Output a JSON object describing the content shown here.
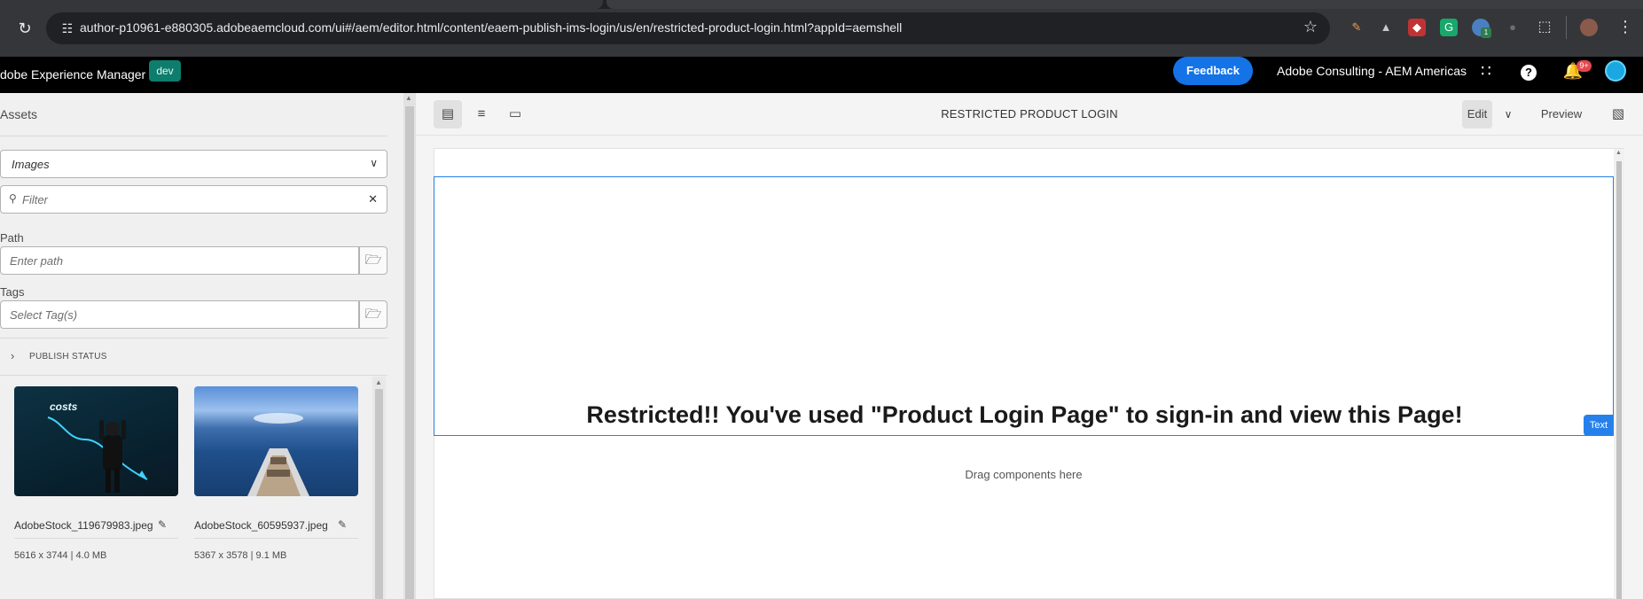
{
  "browser": {
    "url": "author-p10961-e880305.adobeaemcloud.com/ui#/aem/editor.html/content/eaem-publish-ims-login/us/en/restricted-product-login.html?appId=aemshell",
    "extension_badge": "1"
  },
  "aem_header": {
    "brand": "dobe Experience Manager",
    "env_badge": "dev",
    "feedback_label": "Feedback",
    "org_name": "Adobe Consulting - AEM Americas",
    "notification_count": "9+"
  },
  "assets_panel": {
    "title": "Assets",
    "type_select": "Images",
    "filter_placeholder": "Filter",
    "path_label": "Path",
    "path_placeholder": "Enter path",
    "tags_label": "Tags",
    "tags_placeholder": "Select Tag(s)",
    "publish_status_label": "PUBLISH STATUS",
    "cards": [
      {
        "name": "AdobeStock_119679983.jpeg",
        "meta": "5616 x 3744 | 4.0 MB",
        "thumb_text": "costs"
      },
      {
        "name": "AdobeStock_60595937.jpeg",
        "meta": "5367 x 3578 | 9.1 MB"
      }
    ]
  },
  "editor": {
    "page_title": "RESTRICTED PRODUCT LOGIN",
    "edit_label": "Edit",
    "preview_label": "Preview",
    "headline": "Restricted!! You've used \"Product Login Page\" to sign-in and view this Page!",
    "component_tag": "Text",
    "drop_zone": "Drag components here"
  },
  "colors": {
    "accent_blue": "#1473e6",
    "selection_blue": "#2680eb",
    "env_badge_teal": "#0d7d6e",
    "notification_red": "#e34850"
  }
}
